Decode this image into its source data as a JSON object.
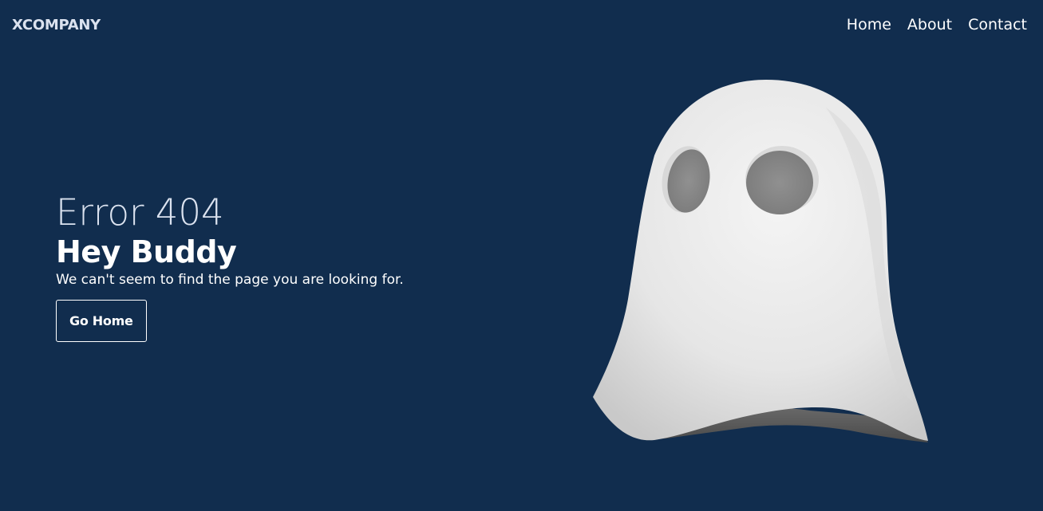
{
  "navbar": {
    "logo": "XCOMPANY",
    "links": [
      {
        "label": "Home"
      },
      {
        "label": "About"
      },
      {
        "label": "Contact"
      }
    ]
  },
  "hero": {
    "error_code": "Error 404",
    "headline": "Hey Buddy",
    "message": "We can't seem to find the page you are looking for.",
    "button_label": "Go Home"
  },
  "illustration": {
    "icon": "ghost-illustration"
  },
  "colors": {
    "background": "#112d4e",
    "accent_light": "#dbe2ef",
    "text": "#ffffff"
  }
}
